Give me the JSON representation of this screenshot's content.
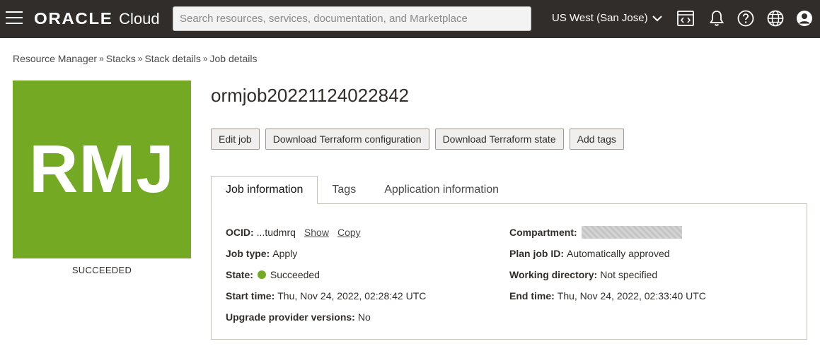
{
  "header": {
    "brand": "ORACLE",
    "product": "Cloud",
    "search_placeholder": "Search resources, services, documentation, and Marketplace",
    "region": "US West (San Jose)",
    "icons": [
      "menu-icon",
      "cloud-shell-icon",
      "bell-icon",
      "help-icon",
      "globe-icon",
      "user-icon"
    ]
  },
  "breadcrumb": {
    "items": [
      "Resource Manager",
      "Stacks",
      "Stack details"
    ],
    "current": "Job details"
  },
  "avatar": {
    "initials": "RMJ",
    "status": "SUCCEEDED",
    "color": "#74a924"
  },
  "title": "ormjob20221124022842",
  "actions": {
    "edit": "Edit job",
    "download_config": "Download Terraform configuration",
    "download_state": "Download Terraform state",
    "add_tags": "Add tags"
  },
  "tabs": {
    "job_info": "Job information",
    "tags": "Tags",
    "app_info": "Application information"
  },
  "job_info": {
    "ocid_label": "OCID:",
    "ocid_value": "...tudmrq",
    "show": "Show",
    "copy": "Copy",
    "job_type_label": "Job type:",
    "job_type_value": "Apply",
    "state_label": "State:",
    "state_value": "Succeeded",
    "start_label": "Start time:",
    "start_value": "Thu, Nov 24, 2022, 02:28:42 UTC",
    "upgrade_label": "Upgrade provider versions:",
    "upgrade_value": "No",
    "compartment_label": "Compartment:",
    "plan_label": "Plan job ID:",
    "plan_value": "Automatically approved",
    "workdir_label": "Working directory:",
    "workdir_value": "Not specified",
    "end_label": "End time:",
    "end_value": "Thu, Nov 24, 2022, 02:33:40 UTC"
  }
}
